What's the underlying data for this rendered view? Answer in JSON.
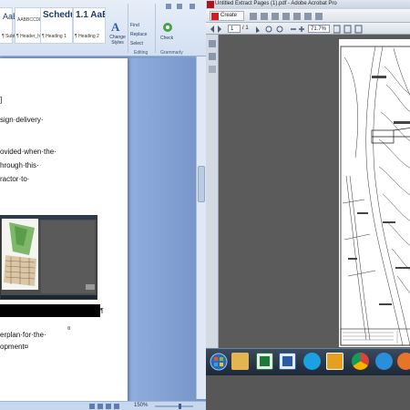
{
  "word": {
    "ribbon": {
      "styles": [
        {
          "sample": "AaBbCcDc",
          "name": "¶ Subtitle"
        },
        {
          "sample": "AABBCCDD",
          "name": "¶ Header_hi..."
        },
        {
          "sample": "Schedu",
          "name": "¶ Heading 1"
        },
        {
          "sample": "1.1 AaB",
          "name": "¶ Heading 2"
        }
      ],
      "change_styles": "Change Styles",
      "find": "Find",
      "replace": "Replace",
      "select": "Select",
      "check": "Check",
      "editing_group": "Editing",
      "grammarly_group": "Grammarly"
    },
    "document": {
      "lines": [
        "]",
        "sign·delivery·",
        "ovided·when·the·",
        "hrough·this·",
        "ractor·to·"
      ],
      "after_image_lines": [
        "erplan·for·the·",
        "opment¤"
      ],
      "para_mark": "¶",
      "cell_mark": "¤"
    },
    "status_zoom": "150%"
  },
  "acrobat": {
    "window_title": "Untitled Extract Pages (1).pdf - Adobe Acrobat Pro",
    "create_label": "Create",
    "page_current": "1",
    "page_total": "/ 1",
    "zoom": "71.7%"
  },
  "colors": {
    "word_frame": "#7e9ccd",
    "ribbon_bg": "#dbe6f4",
    "acrobat_bg": "#5b5b5b",
    "taskbar_bg": "#1d2836",
    "pdf_page": "#ffffff"
  },
  "taskbar_icons": [
    "windows-explorer-icon",
    "excel-icon",
    "word-icon",
    "skype-icon",
    "acrobat-icon",
    "chrome-icon",
    "internet-explorer-icon",
    "firefox-icon"
  ]
}
